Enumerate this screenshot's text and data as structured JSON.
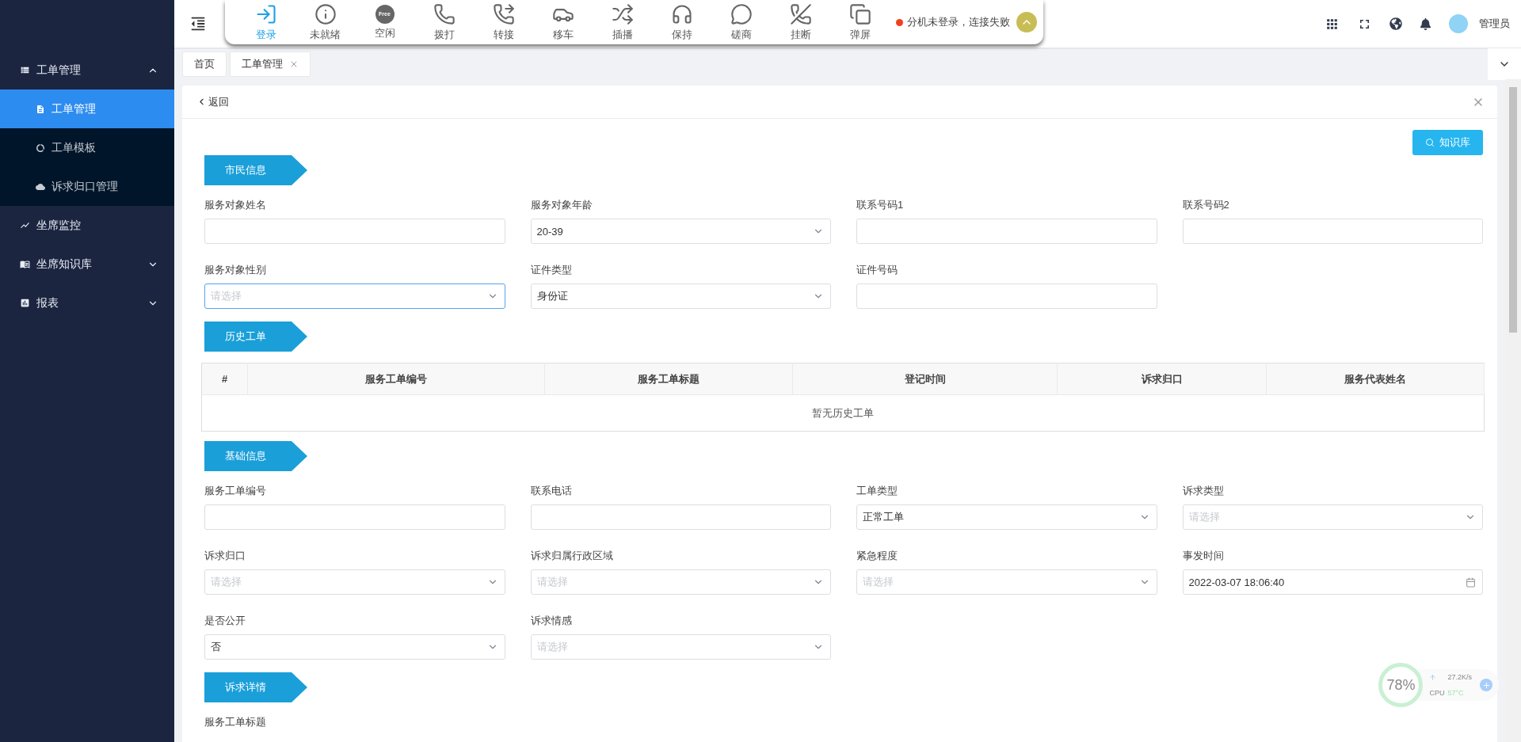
{
  "sidebar": {
    "items": [
      {
        "label": "工单管理",
        "kind": "group",
        "expanded": true,
        "children": [
          {
            "label": "工单管理",
            "selected": true
          },
          {
            "label": "工单模板",
            "selected": false
          },
          {
            "label": "诉求归口管理",
            "selected": false
          }
        ]
      },
      {
        "label": "坐席监控",
        "kind": "link"
      },
      {
        "label": "坐席知识库",
        "kind": "group",
        "expanded": false
      },
      {
        "label": "报表",
        "kind": "group",
        "expanded": false
      }
    ]
  },
  "toolbar": {
    "buttons": [
      {
        "label": "登录",
        "selected": true
      },
      {
        "label": "未就绪",
        "selected": false
      },
      {
        "label": "空闲",
        "selected": false,
        "badge": "Free"
      },
      {
        "label": "拨打",
        "selected": false
      },
      {
        "label": "转接",
        "selected": false
      },
      {
        "label": "移车",
        "selected": false
      },
      {
        "label": "插播",
        "selected": false
      },
      {
        "label": "保持",
        "selected": false
      },
      {
        "label": "磋商",
        "selected": false
      },
      {
        "label": "挂断",
        "selected": false
      },
      {
        "label": "弹屏",
        "selected": false
      }
    ],
    "status": {
      "text": "分机未登录，连接失败",
      "color": "#f0401f"
    }
  },
  "header": {
    "user": "管理员"
  },
  "tabs": [
    {
      "label": "首页",
      "closable": false
    },
    {
      "label": "工单管理",
      "closable": true
    }
  ],
  "card": {
    "back": "返回",
    "knowledge_button": "知识库",
    "sections": [
      {
        "title": "市民信息",
        "kind": "fields",
        "fields": [
          {
            "label": "服务对象姓名",
            "kind": "input",
            "focused": false
          },
          {
            "label": "服务对象年龄",
            "kind": "select",
            "value": "20-39",
            "focused": false
          },
          {
            "label": "联系号码1",
            "kind": "input",
            "focused": false
          },
          {
            "label": "联系号码2",
            "kind": "input",
            "focused": false
          },
          {
            "label": "服务对象性别",
            "kind": "select",
            "placeholder": "请选择",
            "focused": true
          },
          {
            "label": "证件类型",
            "kind": "select",
            "value": "身份证",
            "focused": false
          },
          {
            "label": "证件号码",
            "kind": "input",
            "focused": false
          }
        ]
      },
      {
        "title": "历史工单",
        "kind": "table",
        "columns": [
          "#",
          "服务工单编号",
          "服务工单标题",
          "登记时间",
          "诉求归口",
          "服务代表姓名"
        ],
        "empty": "暂无历史工单"
      },
      {
        "title": "基础信息",
        "kind": "fields",
        "fields": [
          {
            "label": "服务工单编号",
            "kind": "input",
            "focused": false
          },
          {
            "label": "联系电话",
            "kind": "input",
            "focused": false
          },
          {
            "label": "工单类型",
            "kind": "select",
            "value": "正常工单",
            "focused": false
          },
          {
            "label": "诉求类型",
            "kind": "select",
            "placeholder": "请选择",
            "focused": false
          },
          {
            "label": "诉求归口",
            "kind": "select",
            "placeholder": "请选择",
            "focused": false
          },
          {
            "label": "诉求归属行政区域",
            "kind": "select",
            "placeholder": "请选择",
            "focused": false
          },
          {
            "label": "紧急程度",
            "kind": "select",
            "placeholder": "请选择",
            "focused": false
          },
          {
            "label": "事发时间",
            "kind": "date",
            "value": "2022-03-07 18:06:40",
            "focused": false
          },
          {
            "label": "是否公开",
            "kind": "select",
            "value": "否",
            "focused": false
          },
          {
            "label": "诉求情感",
            "kind": "select",
            "placeholder": "请选择",
            "focused": false
          }
        ]
      },
      {
        "title": "诉求详情",
        "kind": "fields",
        "fields": [
          {
            "label": "服务工单标题",
            "kind": "label"
          }
        ]
      }
    ]
  },
  "monitor": {
    "percent": "78%",
    "speed": "27.2K/s",
    "cpu_label": "CPU",
    "temperature": "57°C"
  }
}
